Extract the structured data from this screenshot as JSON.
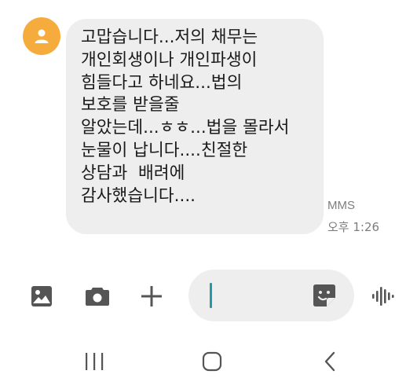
{
  "message": {
    "lines": [
      "고맙습니다...저의 채무는",
      "개인회생이나 개인파생이",
      "힘들다고 하네요...법의",
      "보호를 받을줄",
      "알았는데...ㅎㅎ...법을 몰라서",
      "눈물이 납니다....친절한",
      "상담과  배려에",
      "감사했습니다...."
    ],
    "type": "MMS",
    "time": "오후 1:26"
  },
  "composer": {
    "text": "",
    "icons": [
      "image-icon",
      "camera-icon",
      "plus-icon",
      "sticker-icon",
      "voice-icon"
    ]
  },
  "navbar": {
    "icons": [
      "recent-apps-icon",
      "home-icon",
      "back-icon"
    ]
  },
  "colors": {
    "avatar_bg": "#f6ac3c",
    "bubble_bg": "#eeeeee",
    "icon_gray": "#555555",
    "cursor": "#1f9aa8"
  }
}
